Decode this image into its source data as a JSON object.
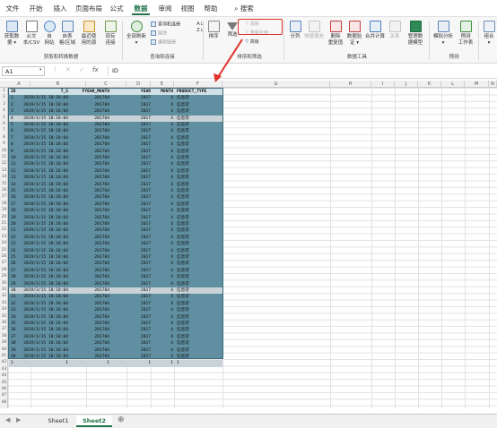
{
  "menu": {
    "tabs": [
      "文件",
      "开始",
      "插入",
      "页面布局",
      "公式",
      "数据",
      "审阅",
      "视图",
      "帮助"
    ],
    "active": "数据",
    "search": "搜索"
  },
  "ribbon": {
    "get_data": "获取数\n据 ▾",
    "from_csv": "从文\n本/CSV",
    "from_web": "自\n网站",
    "from_table": "自表\n格/区域",
    "recent": "最近使\n用的源",
    "existing": "现有\n连接",
    "group1": "获取和转换数据",
    "refresh_all": "全部刷新\n▾",
    "queries": "查询和连接",
    "properties": "属性",
    "edit_links": "编辑链接",
    "group2": "查询和连接",
    "sort": "排序",
    "filter": "筛选",
    "clear": "清除",
    "reapply": "重新应用",
    "advanced": "高级",
    "group3": "排序和筛选",
    "split": "分列",
    "flash": "快速填充",
    "remove_dup": "删除\n重复值",
    "validation": "数据验\n证 ▾",
    "consolidate": "合并计算",
    "relations": "关系",
    "data_model": "管理数\n据模型",
    "group4": "数据工具",
    "whatif": "模拟分析\n▾",
    "forecast": "预测\n工作表",
    "group5": "预测",
    "outline": "组合\n▾"
  },
  "formula_bar": {
    "cell": "A1",
    "content": "ID"
  },
  "columns": [
    "A",
    "B",
    "C",
    "D",
    "E",
    "F",
    "G",
    "H",
    "I",
    "J",
    "K",
    "L",
    "M",
    "N"
  ],
  "table": {
    "headers": [
      "ID",
      "T_S",
      "FYEAR_MONTH",
      "YEAR",
      "MONTH",
      "PRODUCT_TYPE"
    ],
    "rows": [
      [
        "1",
        "2019/3/15 18:18:04",
        "201704",
        "2017",
        "4",
        "信息贷"
      ],
      [
        "2",
        "2019/3/15 18:18:04",
        "201704",
        "2017",
        "4",
        "信息贷"
      ],
      [
        "3",
        "2019/3/15 18:18:04",
        "201704",
        "2017",
        "4",
        "信息贷"
      ],
      [
        "4",
        "2019/3/15 18:18:04",
        "201704",
        "2017",
        "4",
        "信息贷"
      ],
      [
        "5",
        "2019/3/15 18:18:04",
        "201704",
        "2017",
        "4",
        "信息贷"
      ],
      [
        "6",
        "2019/3/15 18:18:04",
        "201704",
        "2017",
        "4",
        "信息贷"
      ],
      [
        "7",
        "2019/3/15 18:18:04",
        "201704",
        "2017",
        "4",
        "信息贷"
      ],
      [
        "8",
        "2019/3/15 18:18:04",
        "201704",
        "2017",
        "4",
        "信息贷"
      ],
      [
        "9",
        "2019/3/15 18:18:04",
        "201704",
        "2017",
        "4",
        "信息贷"
      ],
      [
        "10",
        "2019/3/15 18:18:04",
        "201704",
        "2017",
        "4",
        "信息贷"
      ],
      [
        "11",
        "2019/3/15 18:18:04",
        "201704",
        "2017",
        "4",
        "信息贷"
      ],
      [
        "12",
        "2019/3/15 18:18:04",
        "201704",
        "2017",
        "4",
        "信息贷"
      ],
      [
        "13",
        "2019/3/15 18:18:04",
        "201704",
        "2017",
        "4",
        "信息贷"
      ],
      [
        "14",
        "2019/3/15 18:18:04",
        "201704",
        "2017",
        "4",
        "信息贷"
      ],
      [
        "15",
        "2019/3/15 18:18:04",
        "201704",
        "2017",
        "4",
        "信息贷"
      ],
      [
        "16",
        "2019/3/15 18:18:04",
        "201704",
        "2017",
        "4",
        "信息贷"
      ],
      [
        "17",
        "2019/3/15 18:18:04",
        "201704",
        "2017",
        "4",
        "信息贷"
      ],
      [
        "18",
        "2019/3/15 18:18:04",
        "201704",
        "2017",
        "4",
        "信息贷"
      ],
      [
        "19",
        "2019/3/15 18:18:04",
        "201704",
        "2017",
        "4",
        "信息贷"
      ],
      [
        "20",
        "2019/3/15 18:18:04",
        "201704",
        "2017",
        "4",
        "信息贷"
      ],
      [
        "21",
        "2019/3/15 18:18:04",
        "201704",
        "2017",
        "4",
        "信息贷"
      ],
      [
        "22",
        "2019/3/15 18:18:04",
        "201704",
        "2017",
        "4",
        "信息贷"
      ],
      [
        "23",
        "2019/3/15 18:18:04",
        "201704",
        "2017",
        "4",
        "信息贷"
      ],
      [
        "24",
        "2019/3/15 18:18:04",
        "201704",
        "2017",
        "4",
        "信息贷"
      ],
      [
        "25",
        "2019/3/15 18:18:04",
        "201704",
        "2017",
        "4",
        "信息贷"
      ],
      [
        "26",
        "2019/3/15 18:18:04",
        "201704",
        "2017",
        "4",
        "信息贷"
      ],
      [
        "27",
        "2019/3/15 18:18:04",
        "201704",
        "2017",
        "4",
        "信息贷"
      ],
      [
        "28",
        "2019/3/15 18:18:04",
        "201704",
        "2017",
        "4",
        "信息贷"
      ],
      [
        "29",
        "2019/3/15 18:18:04",
        "201704",
        "2017",
        "4",
        "信息贷"
      ],
      [
        "30",
        "2019/3/15 18:18:04",
        "201704",
        "2017",
        "4",
        "信息贷"
      ],
      [
        "31",
        "2019/3/15 18:18:04",
        "201704",
        "2017",
        "4",
        "信息贷"
      ],
      [
        "32",
        "2019/3/15 18:18:04",
        "201704",
        "2017",
        "4",
        "信息贷"
      ],
      [
        "33",
        "2019/3/15 18:18:04",
        "201704",
        "2017",
        "4",
        "信息贷"
      ],
      [
        "34",
        "2019/3/15 18:18:04",
        "201704",
        "2017",
        "4",
        "信息贷"
      ],
      [
        "35",
        "2019/3/15 18:18:04",
        "201704",
        "2017",
        "4",
        "信息贷"
      ],
      [
        "36",
        "2019/3/15 18:18:04",
        "201704",
        "2017",
        "4",
        "信息贷"
      ],
      [
        "37",
        "2019/3/15 18:18:04",
        "201704",
        "2017",
        "4",
        "信息贷"
      ],
      [
        "38",
        "2019/3/15 18:18:04",
        "201704",
        "2017",
        "4",
        "信息贷"
      ],
      [
        "39",
        "2019/3/15 18:18:04",
        "201704",
        "2017",
        "4",
        "信息贷"
      ],
      [
        "40",
        "2019/3/15 18:18:04",
        "201704",
        "2017",
        "4",
        "信息贷"
      ],
      [
        "1",
        "1",
        "1",
        "1",
        "1",
        "1"
      ]
    ]
  },
  "sheets": [
    "Sheet1",
    "Sheet2"
  ],
  "active_sheet": "Sheet2",
  "add_sheet": "⊕",
  "colors": {
    "accent": "#217346",
    "table_fill": "#5f8fa0",
    "highlight": "#e0312b"
  }
}
